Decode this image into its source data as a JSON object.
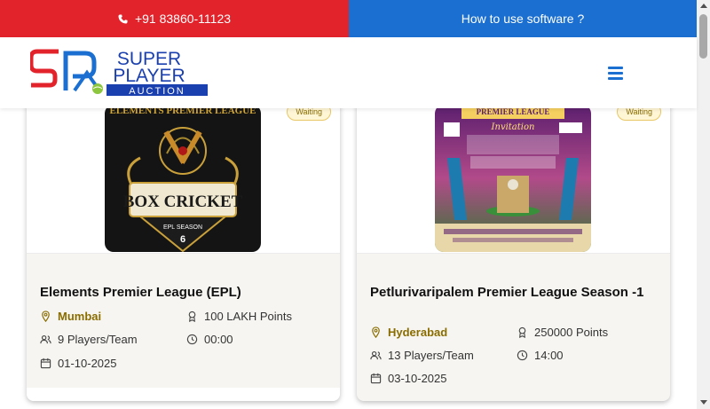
{
  "topbar": {
    "phone": "+91 83860-11123",
    "howto": "How to use software ?"
  },
  "header": {
    "logo_line1": "SUPER",
    "logo_line2": "PLAYER",
    "logo_line3": "AUCTION",
    "menu_icon": "hamburger-icon"
  },
  "colors": {
    "topbar_call": "#e3232b",
    "topbar_howto": "#1a6fd1",
    "accent_gold": "#8a6d00"
  },
  "leagues": [
    {
      "status": "Waiting",
      "poster_text1": "ELEMENTS PREMIER LEAGUE",
      "poster_text2": "BOX CRICKET",
      "poster_text3": "EPL SEASON",
      "poster_text4": "6",
      "title": "Elements Premier League (EPL)",
      "city": "Mumbai",
      "points": "100 LAKH Points",
      "players": "9 Players/Team",
      "time": "00:00",
      "date": "01-10-2025"
    },
    {
      "status": "Waiting",
      "poster_text1": "PREMIER LEAGUE",
      "poster_text2": "Invitation",
      "title": "Petlurivaripalem Premier League Season -1",
      "city": "Hyderabad",
      "points": "250000 Points",
      "players": "13 Players/Team",
      "time": "14:00",
      "date": "03-10-2025"
    }
  ]
}
